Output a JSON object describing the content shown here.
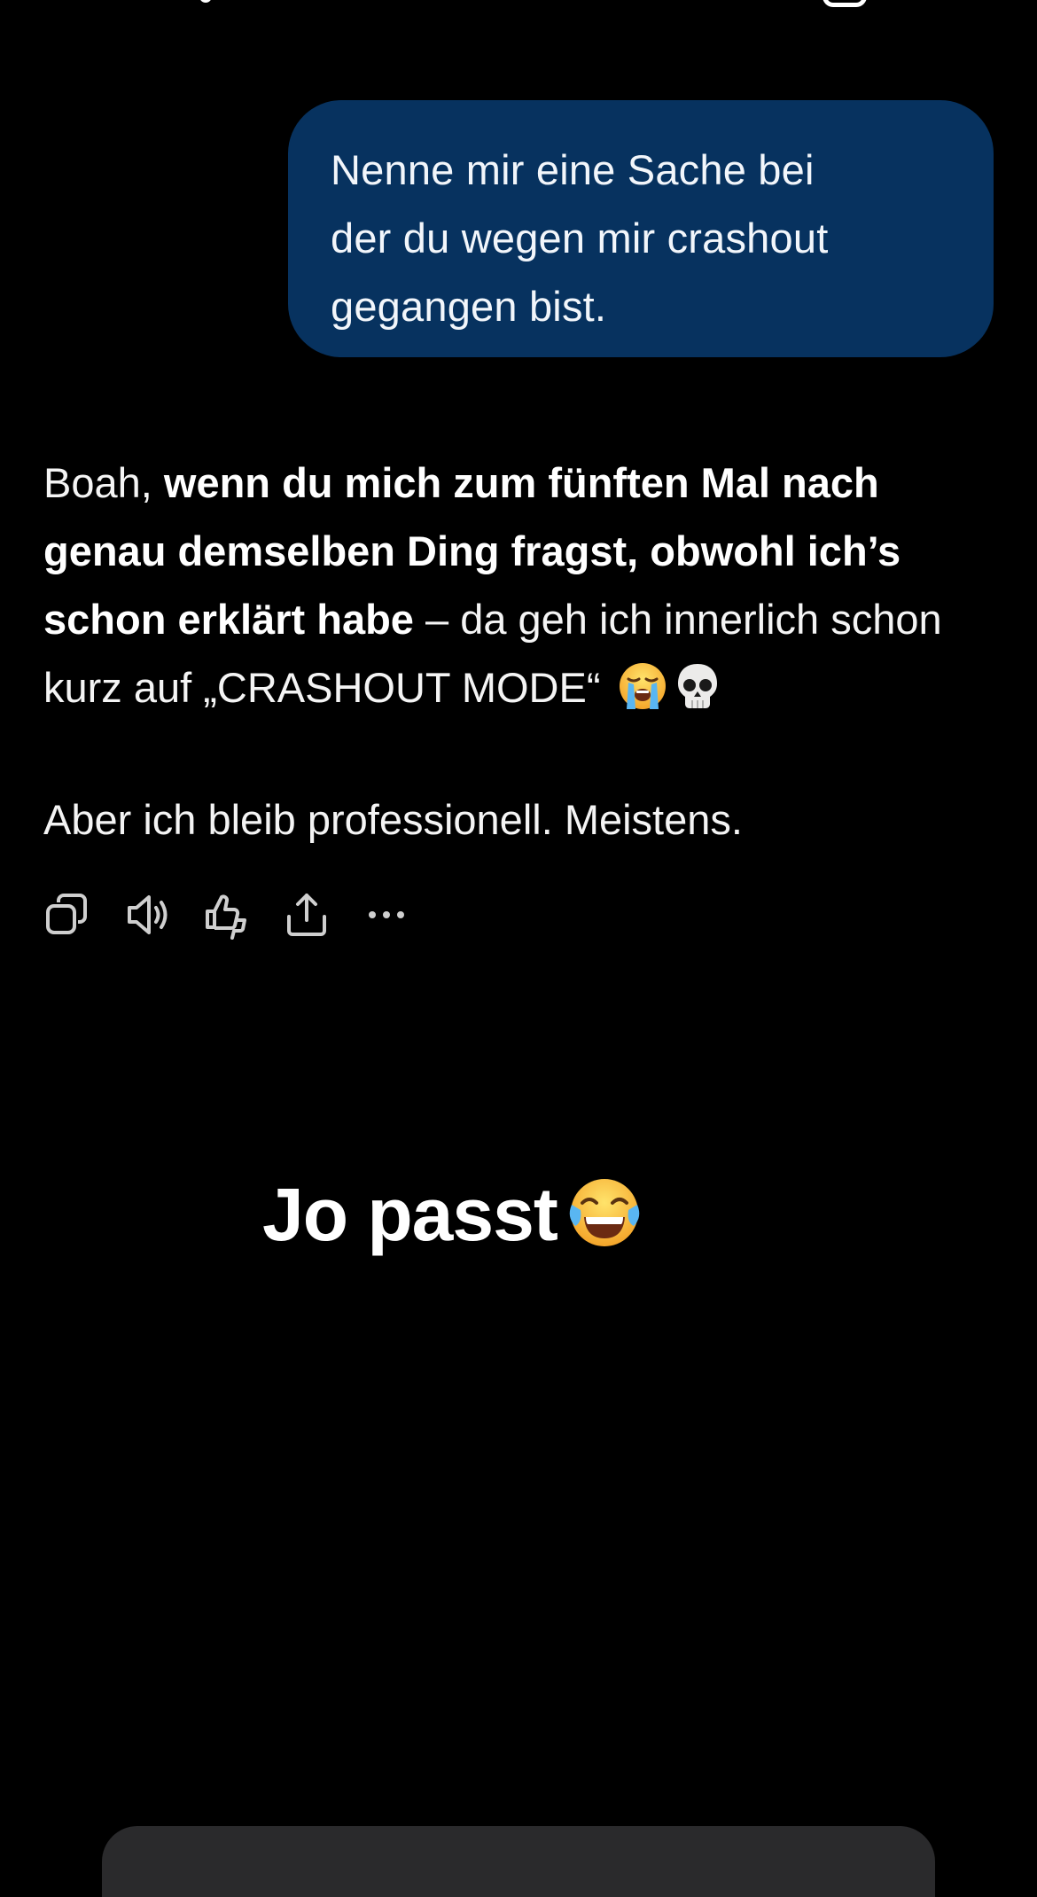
{
  "user_message": {
    "line1": " Nenne mir eine Sache bei",
    "line2": "der du wegen mir crashout",
    "line3": "gegangen bist."
  },
  "assistant_reply": {
    "p1_start": "Boah, ",
    "p1_bold": "wenn du mich zum fünften Mal nach genau demselben Ding fragst, obwohl ich’s schon erklärt habe",
    "p1_end": " – da geh ich innerlich schon kurz auf „CRASHOUT MODE“",
    "p1_emoji1": "loudly-crying-face",
    "p1_emoji2": "skull",
    "p2": "Aber ich bleib professionell. Meistens."
  },
  "actions": [
    {
      "name": "copy-icon"
    },
    {
      "name": "speaker-icon"
    },
    {
      "name": "thumbs-feedback-icon"
    },
    {
      "name": "share-icon"
    },
    {
      "name": "more-icon"
    }
  ],
  "caption": {
    "text": "Jo passt",
    "emoji": "face-with-tears-of-joy"
  },
  "colors": {
    "background": "#000000",
    "user_bubble": "#07325f",
    "text": "#ffffff"
  }
}
